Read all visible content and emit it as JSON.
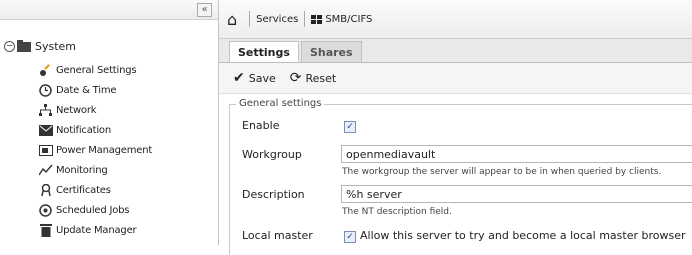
{
  "sidebar": {
    "collapse_glyph": "«",
    "root_label": "System",
    "items": [
      {
        "label": "General Settings",
        "icon": "wrench-icon"
      },
      {
        "label": "Date & Time",
        "icon": "clock-icon"
      },
      {
        "label": "Network",
        "icon": "network-icon"
      },
      {
        "label": "Notification",
        "icon": "mail-icon"
      },
      {
        "label": "Power Management",
        "icon": "power-icon"
      },
      {
        "label": "Monitoring",
        "icon": "chart-icon"
      },
      {
        "label": "Certificates",
        "icon": "certificate-icon"
      },
      {
        "label": "Scheduled Jobs",
        "icon": "clock-icon"
      },
      {
        "label": "Update Manager",
        "icon": "trash-icon"
      }
    ]
  },
  "breadcrumb": {
    "items": [
      "Services",
      "SMB/CIFS"
    ]
  },
  "tabs": [
    "Settings",
    "Shares"
  ],
  "toolbar": {
    "save_label": "Save",
    "reset_label": "Reset"
  },
  "form": {
    "legend": "General settings",
    "enable_label": "Enable",
    "enable_checked": true,
    "workgroup_label": "Workgroup",
    "workgroup_value": "openmediavault",
    "workgroup_hint": "The workgroup the server will appear to be in when queried by clients.",
    "description_label": "Description",
    "description_value": "%h server",
    "description_hint": "The NT description field.",
    "local_master_label": "Local master",
    "local_master_checked": true,
    "local_master_text": "Allow this server to try and become a local master browser"
  }
}
